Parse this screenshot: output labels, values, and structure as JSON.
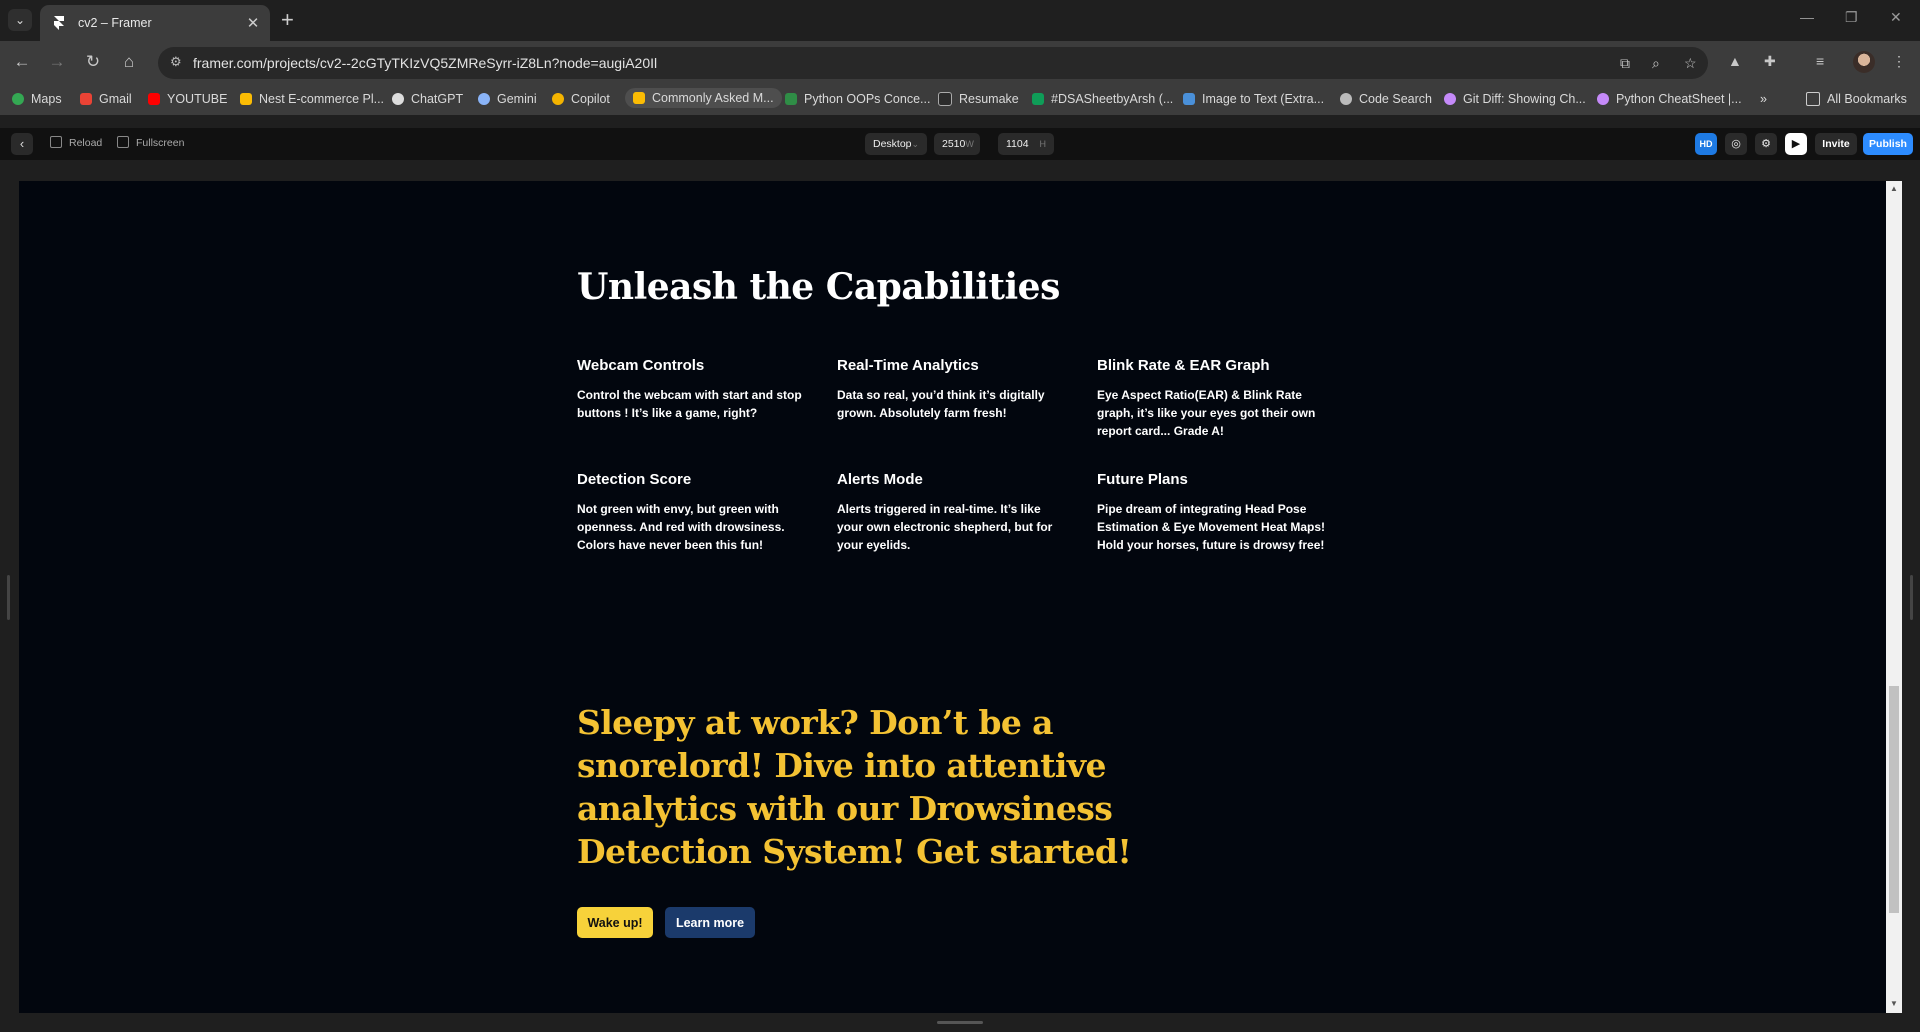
{
  "browser": {
    "tab_title": "cv2 – Framer",
    "url": "framer.com/projects/cv2--2cGTyTKIzVQ5ZMReSyrr-iZ8Ln?node=augiA20Il",
    "bookmarks": [
      {
        "label": "Maps",
        "color": "#34a853"
      },
      {
        "label": "Gmail",
        "color": "#ea4335"
      },
      {
        "label": "YOUTUBE",
        "color": "#ff0000"
      },
      {
        "label": "Nest E-commerce Pl...",
        "color": "#fbbc04"
      },
      {
        "label": "ChatGPT",
        "color": "#dddddd"
      },
      {
        "label": "Gemini",
        "color": "#8ab4f8"
      },
      {
        "label": "Copilot",
        "color": "#f4b400"
      },
      {
        "label": "Commonly Asked M...",
        "color": "#fbbc04"
      },
      {
        "label": "Python OOPs Conce...",
        "color": "#2f8d46"
      },
      {
        "label": "Resumake",
        "color": "#2b2b2b"
      },
      {
        "label": "#DSASheetbyArsh (...",
        "color": "#0f9d58"
      },
      {
        "label": "Image to Text (Extra...",
        "color": "#4a90d9"
      },
      {
        "label": "Code Search",
        "color": "#bbbbbb"
      },
      {
        "label": "Git Diff: Showing Ch...",
        "color": "#c58af9"
      },
      {
        "label": "Python CheatSheet |...",
        "color": "#c58af9"
      }
    ],
    "all_bookmarks": "All Bookmarks"
  },
  "framer": {
    "reload": "Reload",
    "fullscreen": "Fullscreen",
    "device": "Desktop",
    "width": "2510",
    "width_unit": "W",
    "height": "1104",
    "height_unit": "H",
    "hd": "HD",
    "invite": "Invite",
    "publish": "Publish"
  },
  "page": {
    "heading": "Unleash the Capabilities",
    "features": [
      {
        "title": "Webcam Controls",
        "desc": "Control the webcam with start and stop buttons ! It’s like a game, right?"
      },
      {
        "title": "Real-Time Analytics",
        "desc": "Data so real, you’d think it’s digitally grown. Absolutely farm fresh!"
      },
      {
        "title": "Blink Rate & EAR Graph",
        "desc": "Eye Aspect Ratio(EAR) & Blink Rate graph, it’s like your eyes got their own report card... Grade A!"
      },
      {
        "title": "Detection Score",
        "desc": "Not green with envy, but green with openness. And red with drowsiness. Colors have never been this fun!"
      },
      {
        "title": "Alerts Mode",
        "desc": "Alerts triggered in real-time. It’s like your own electronic shepherd, but for your eyelids."
      },
      {
        "title": "Future Plans",
        "desc": "Pipe dream of integrating Head Pose Estimation & Eye Movement Heat Maps! Hold your horses, future is drowsy free!"
      }
    ],
    "cta": "Sleepy at work? Don’t be a snorelord! Dive into attentive analytics with our Drowsiness Detection System! Get started!",
    "wake_button": "Wake up!",
    "learn_button": "Learn more"
  }
}
